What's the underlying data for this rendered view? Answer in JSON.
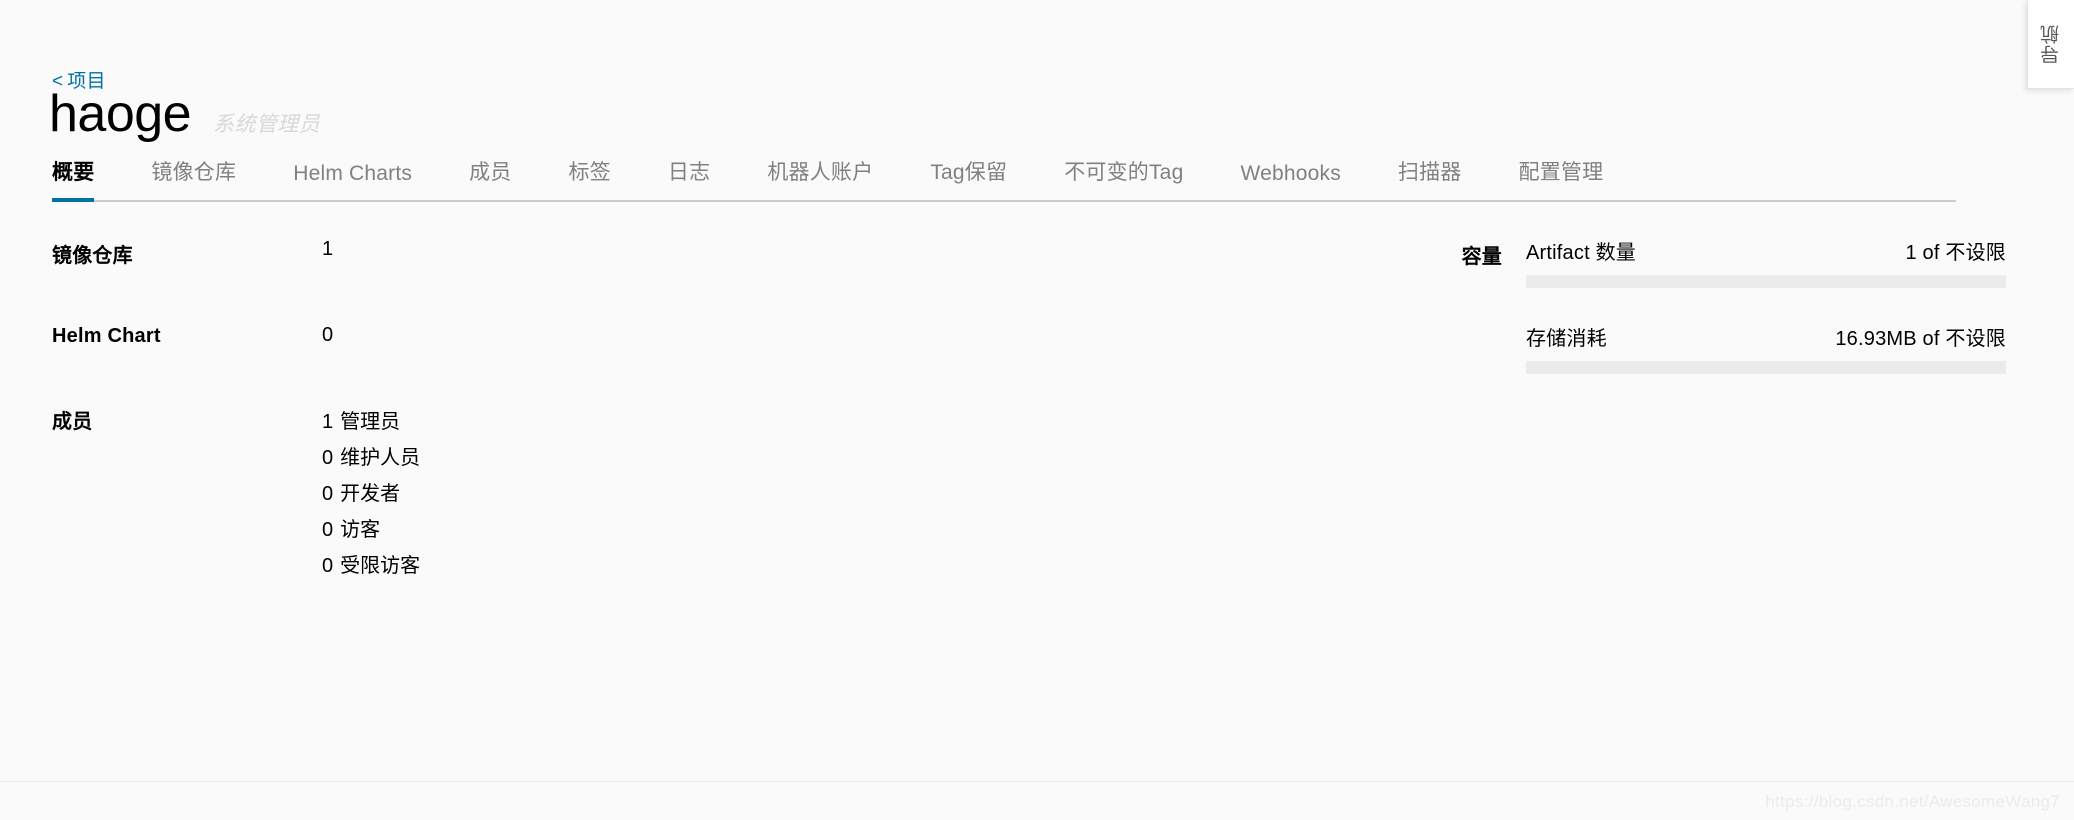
{
  "colors": {
    "accent": "#0072a3",
    "background": "#fafafa",
    "tab_inactive": "#808080",
    "tab_active": "#000000",
    "progress_track": "#ebebeb",
    "role_text": "#d8d8d8"
  },
  "side_flap": {
    "label": "导航"
  },
  "header": {
    "breadcrumb_chevron": "<",
    "breadcrumb_label": "项目",
    "project_name": "haoge",
    "project_role": "系统管理员"
  },
  "tabs": [
    {
      "label": "概要",
      "active": true
    },
    {
      "label": "镜像仓库",
      "active": false
    },
    {
      "label": "Helm Charts",
      "active": false
    },
    {
      "label": "成员",
      "active": false
    },
    {
      "label": "标签",
      "active": false
    },
    {
      "label": "日志",
      "active": false
    },
    {
      "label": "机器人账户",
      "active": false
    },
    {
      "label": "Tag保留",
      "active": false
    },
    {
      "label": "不可变的Tag",
      "active": false
    },
    {
      "label": "Webhooks",
      "active": false
    },
    {
      "label": "扫描器",
      "active": false
    },
    {
      "label": "配置管理",
      "active": false
    }
  ],
  "summary": {
    "repositories": {
      "label": "镜像仓库",
      "value": "1"
    },
    "helm_chart": {
      "label": "Helm Chart",
      "value": "0"
    },
    "members": {
      "label": "成员",
      "rows": [
        {
          "count": "1",
          "role": "管理员"
        },
        {
          "count": "0",
          "role": "维护人员"
        },
        {
          "count": "0",
          "role": "开发者"
        },
        {
          "count": "0",
          "role": "访客"
        },
        {
          "count": "0",
          "role": "受限访客"
        }
      ]
    }
  },
  "capacity": {
    "label": "容量",
    "quotas": [
      {
        "name": "Artifact 数量",
        "used": "1",
        "separator": "of",
        "limit": "不设限",
        "amount": "1 of 不设限",
        "percent": 0
      },
      {
        "name": "存储消耗",
        "used": "16.93MB",
        "separator": "of",
        "limit": "不设限",
        "amount": "16.93MB of 不设限",
        "percent": 0
      }
    ]
  },
  "watermark": {
    "text": "https://blog.csdn.net/AwesomeWang7"
  }
}
